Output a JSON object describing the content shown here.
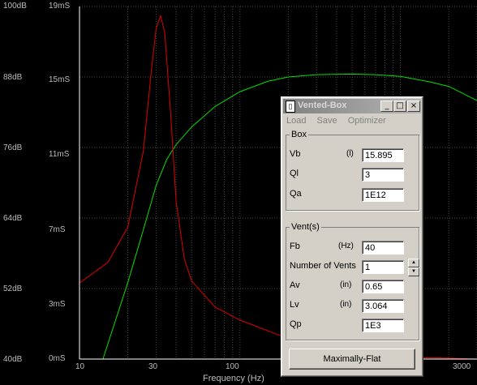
{
  "left_axis": {
    "labels": [
      "100dB",
      "88dB",
      "76dB",
      "64dB",
      "52dB",
      "40dB"
    ]
  },
  "inner_axis": {
    "labels": [
      "19mS",
      "15mS",
      "11mS",
      "7mS",
      "3mS",
      "0mS"
    ]
  },
  "x_axis": {
    "labels": [
      "10",
      "30",
      "100",
      "3000"
    ],
    "title": "Frequency (Hz)"
  },
  "colors": {
    "grid": "#4a4a4a",
    "response": "#00e000",
    "delay": "#e00000",
    "axis": "#ffffff"
  },
  "chart_data": {
    "type": "line",
    "xscale": "log",
    "xlim": [
      10,
      3000
    ],
    "series": [
      {
        "axis": "left_db",
        "x": [
          14,
          20,
          25,
          30,
          35,
          40,
          50,
          70,
          100,
          150,
          200,
          300,
          500,
          700,
          1000,
          1500,
          2000,
          3000
        ],
        "y": [
          40,
          53,
          62,
          69.5,
          74,
          76.5,
          79.5,
          83,
          85.5,
          87.3,
          88,
          88.4,
          88.5,
          88.4,
          88.1,
          87.2,
          86.4,
          84
        ]
      },
      {
        "axis": "inner_ms",
        "x": [
          10,
          15,
          20,
          25,
          28,
          30,
          32,
          34,
          37,
          40,
          45,
          50,
          70,
          100,
          200,
          500,
          1000,
          2000,
          3000
        ],
        "y": [
          4.1,
          5.2,
          7.1,
          11.2,
          15.5,
          17.8,
          18.5,
          17.6,
          13.2,
          8.5,
          5.4,
          4.2,
          2.8,
          2.1,
          1.1,
          0.3,
          0.1,
          0.05,
          0.0
        ]
      }
    ]
  },
  "dialog": {
    "title": "Vented-Box",
    "controls": {
      "minimize": "_",
      "maximize": "□",
      "close": "×"
    },
    "menu": [
      "Load",
      "Save",
      "Optimizer"
    ],
    "box": {
      "title": "Box",
      "rows": [
        {
          "label": "Vb",
          "unit": "(l)",
          "value": "15.895"
        },
        {
          "label": "Ql",
          "unit": "",
          "value": "3"
        },
        {
          "label": "Qa",
          "unit": "",
          "value": "1E12"
        }
      ]
    },
    "vents": {
      "title": "Vent(s)",
      "rows": [
        {
          "label": "Fb",
          "unit": "(Hz)",
          "value": "40"
        },
        {
          "label": "Number of Vents",
          "unit": "",
          "value": "1"
        },
        {
          "label": "Av",
          "unit": "(in)",
          "value": "0.65"
        },
        {
          "label": "Lv",
          "unit": "(in)",
          "value": "3.064"
        },
        {
          "label": "Qp",
          "unit": "",
          "value": "1E3"
        }
      ]
    },
    "button": "Maximally-Flat"
  }
}
